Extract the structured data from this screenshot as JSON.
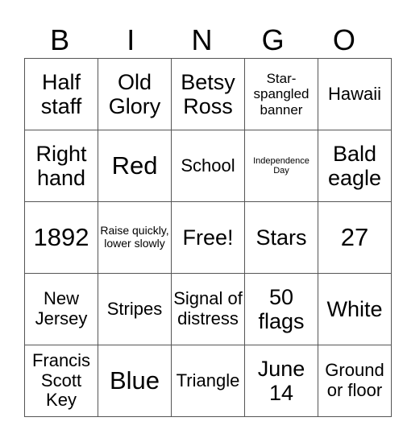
{
  "card": {
    "header": [
      "B",
      "I",
      "N",
      "G",
      "O"
    ],
    "rows": [
      [
        "Half staff",
        "Old Glory",
        "Betsy Ross",
        "Star-spangled banner",
        "Hawaii"
      ],
      [
        "Right hand",
        "Red",
        "School",
        "Independence Day",
        "Bald eagle"
      ],
      [
        "1892",
        "Raise quickly, lower slowly",
        "Free!",
        "Stars",
        "27"
      ],
      [
        "New Jersey",
        "Stripes",
        "Signal of distress",
        "50 flags",
        "White"
      ],
      [
        "Francis Scott Key",
        "Blue",
        "Triangle",
        "June 14",
        "Ground or floor"
      ]
    ]
  }
}
